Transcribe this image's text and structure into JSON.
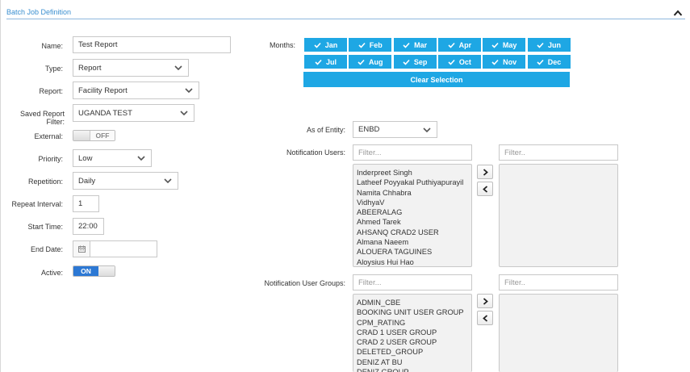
{
  "panel": {
    "title": "Batch Job Definition"
  },
  "form": {
    "name": {
      "label": "Name:",
      "value": "Test Report"
    },
    "type": {
      "label": "Type:",
      "value": "Report"
    },
    "report": {
      "label": "Report:",
      "value": "Facility Report"
    },
    "saved_filter": {
      "label": "Saved Report Filter:",
      "value": "UGANDA TEST"
    },
    "external": {
      "label": "External:",
      "state": "OFF"
    },
    "priority": {
      "label": "Priority:",
      "value": "Low"
    },
    "repetition": {
      "label": "Repetition:",
      "value": "Daily"
    },
    "repeat_interval": {
      "label": "Repeat Interval:",
      "value": "1"
    },
    "start_time": {
      "label": "Start Time:",
      "value": "22:00"
    },
    "end_date": {
      "label": "End Date:",
      "value": ""
    },
    "active": {
      "label": "Active:",
      "state": "ON"
    }
  },
  "months": {
    "label": "Months:",
    "items": [
      "Jan",
      "Feb",
      "Mar",
      "Apr",
      "May",
      "Jun",
      "Jul",
      "Aug",
      "Sep",
      "Oct",
      "Nov",
      "Dec"
    ],
    "clear_label": "Clear Selection",
    "color": "#1ea7e4"
  },
  "entity": {
    "label": "As of Entity:",
    "value": "ENBD"
  },
  "notification_users": {
    "label": "Notification Users:",
    "filter_left_placeholder": "Filter...",
    "filter_right_placeholder": "Filter..",
    "available": [
      "Inderpreet Singh",
      "Latheef Poyyakal Puthiyapurayil",
      "Namita Chhabra",
      "VidhyaV",
      "ABEERALAG",
      "Ahmed Tarek",
      "AHSANQ CRAD2 USER",
      "Almana Naeem",
      "ALOUERA TAGUINES",
      "Aloysius Hui Hao"
    ],
    "move_right": ">",
    "move_left": "<"
  },
  "notification_groups": {
    "label": "Notification User Groups:",
    "filter_left_placeholder": "Filter...",
    "filter_right_placeholder": "Filter..",
    "available": [
      "ADMIN_CBE",
      "BOOKING UNIT USER GROUP",
      "CPM_RATING",
      "CRAD 1 USER GROUP",
      "CRAD 2 USER GROUP",
      "DELETED_GROUP",
      "DENIZ AT BU",
      "DENIZ GROUP"
    ],
    "move_right": ">",
    "move_left": "<"
  },
  "icons": {
    "collapse": "chevron-up-icon",
    "calendar": "calendar-icon",
    "dropdown": "chevron-down-icon",
    "check": "check-icon"
  }
}
